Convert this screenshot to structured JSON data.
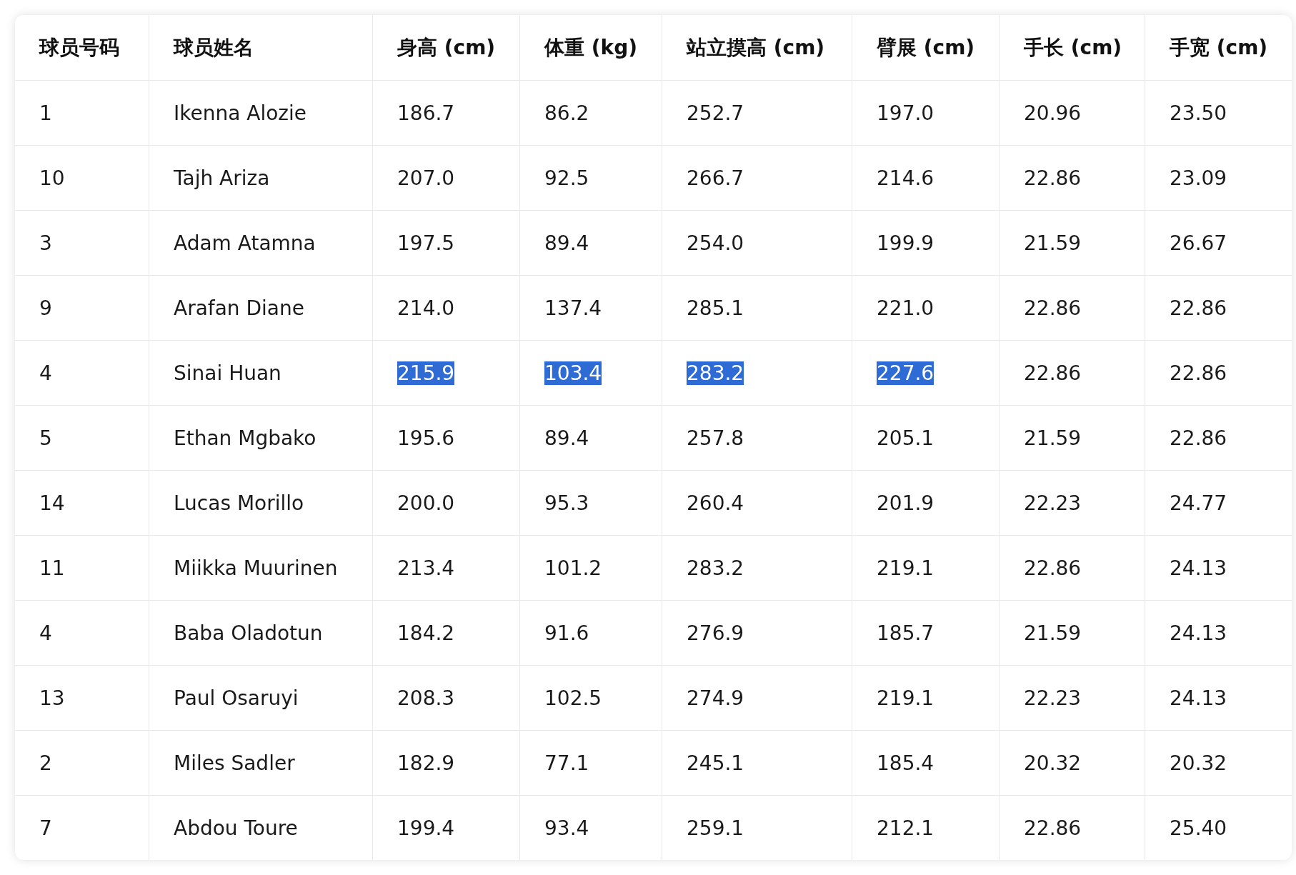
{
  "table": {
    "columns": [
      "球员号码",
      "球员姓名",
      "身高 (cm)",
      "体重 (kg)",
      "站立摸高 (cm)",
      "臂展 (cm)",
      "手长 (cm)",
      "手宽 (cm)"
    ],
    "rows": [
      {
        "cells": [
          {
            "text": "1",
            "selected": false
          },
          {
            "text": "Ikenna Alozie",
            "selected": false
          },
          {
            "text": "186.7",
            "selected": false
          },
          {
            "text": "86.2",
            "selected": false
          },
          {
            "text": "252.7",
            "selected": false
          },
          {
            "text": "197.0",
            "selected": false
          },
          {
            "text": "20.96",
            "selected": false
          },
          {
            "text": "23.50",
            "selected": false
          }
        ]
      },
      {
        "cells": [
          {
            "text": "10",
            "selected": false
          },
          {
            "text": "Tajh Ariza",
            "selected": false
          },
          {
            "text": "207.0",
            "selected": false
          },
          {
            "text": "92.5",
            "selected": false
          },
          {
            "text": "266.7",
            "selected": false
          },
          {
            "text": "214.6",
            "selected": false
          },
          {
            "text": "22.86",
            "selected": false
          },
          {
            "text": "23.09",
            "selected": false
          }
        ]
      },
      {
        "cells": [
          {
            "text": "3",
            "selected": false
          },
          {
            "text": "Adam Atamna",
            "selected": false
          },
          {
            "text": "197.5",
            "selected": false
          },
          {
            "text": "89.4",
            "selected": false
          },
          {
            "text": "254.0",
            "selected": false
          },
          {
            "text": "199.9",
            "selected": false
          },
          {
            "text": "21.59",
            "selected": false
          },
          {
            "text": "26.67",
            "selected": false
          }
        ]
      },
      {
        "cells": [
          {
            "text": "9",
            "selected": false
          },
          {
            "text": "Arafan Diane",
            "selected": false
          },
          {
            "text": "214.0",
            "selected": false
          },
          {
            "text": "137.4",
            "selected": false
          },
          {
            "text": "285.1",
            "selected": false
          },
          {
            "text": "221.0",
            "selected": false
          },
          {
            "text": "22.86",
            "selected": false
          },
          {
            "text": "22.86",
            "selected": false
          }
        ]
      },
      {
        "cells": [
          {
            "text": "4",
            "selected": false
          },
          {
            "text": "Sinai Huan",
            "selected": false
          },
          {
            "text": "215.9",
            "selected": true
          },
          {
            "text": "103.4",
            "selected": true
          },
          {
            "text": "283.2",
            "selected": true
          },
          {
            "text": "227.6",
            "selected": true
          },
          {
            "text": "22.86",
            "selected": false
          },
          {
            "text": "22.86",
            "selected": false
          }
        ]
      },
      {
        "cells": [
          {
            "text": "5",
            "selected": false
          },
          {
            "text": "Ethan Mgbako",
            "selected": false
          },
          {
            "text": "195.6",
            "selected": false
          },
          {
            "text": "89.4",
            "selected": false
          },
          {
            "text": "257.8",
            "selected": false
          },
          {
            "text": "205.1",
            "selected": false
          },
          {
            "text": "21.59",
            "selected": false
          },
          {
            "text": "22.86",
            "selected": false
          }
        ]
      },
      {
        "cells": [
          {
            "text": "14",
            "selected": false
          },
          {
            "text": "Lucas Morillo",
            "selected": false
          },
          {
            "text": "200.0",
            "selected": false
          },
          {
            "text": "95.3",
            "selected": false
          },
          {
            "text": "260.4",
            "selected": false
          },
          {
            "text": "201.9",
            "selected": false
          },
          {
            "text": "22.23",
            "selected": false
          },
          {
            "text": "24.77",
            "selected": false
          }
        ]
      },
      {
        "cells": [
          {
            "text": "11",
            "selected": false
          },
          {
            "text": "Miikka Muurinen",
            "selected": false
          },
          {
            "text": "213.4",
            "selected": false
          },
          {
            "text": "101.2",
            "selected": false
          },
          {
            "text": "283.2",
            "selected": false
          },
          {
            "text": "219.1",
            "selected": false
          },
          {
            "text": "22.86",
            "selected": false
          },
          {
            "text": "24.13",
            "selected": false
          }
        ]
      },
      {
        "cells": [
          {
            "text": "4",
            "selected": false
          },
          {
            "text": "Baba Oladotun",
            "selected": false
          },
          {
            "text": "184.2",
            "selected": false
          },
          {
            "text": "91.6",
            "selected": false
          },
          {
            "text": "276.9",
            "selected": false
          },
          {
            "text": "185.7",
            "selected": false
          },
          {
            "text": "21.59",
            "selected": false
          },
          {
            "text": "24.13",
            "selected": false
          }
        ]
      },
      {
        "cells": [
          {
            "text": "13",
            "selected": false
          },
          {
            "text": "Paul Osaruyi",
            "selected": false
          },
          {
            "text": "208.3",
            "selected": false
          },
          {
            "text": "102.5",
            "selected": false
          },
          {
            "text": "274.9",
            "selected": false
          },
          {
            "text": "219.1",
            "selected": false
          },
          {
            "text": "22.23",
            "selected": false
          },
          {
            "text": "24.13",
            "selected": false
          }
        ]
      },
      {
        "cells": [
          {
            "text": "2",
            "selected": false
          },
          {
            "text": "Miles Sadler",
            "selected": false
          },
          {
            "text": "182.9",
            "selected": false
          },
          {
            "text": "77.1",
            "selected": false
          },
          {
            "text": "245.1",
            "selected": false
          },
          {
            "text": "185.4",
            "selected": false
          },
          {
            "text": "20.32",
            "selected": false
          },
          {
            "text": "20.32",
            "selected": false
          }
        ]
      },
      {
        "cells": [
          {
            "text": "7",
            "selected": false
          },
          {
            "text": "Abdou Toure",
            "selected": false
          },
          {
            "text": "199.4",
            "selected": false
          },
          {
            "text": "93.4",
            "selected": false
          },
          {
            "text": "259.1",
            "selected": false
          },
          {
            "text": "212.1",
            "selected": false
          },
          {
            "text": "22.86",
            "selected": false
          },
          {
            "text": "25.40",
            "selected": false
          }
        ]
      }
    ]
  }
}
